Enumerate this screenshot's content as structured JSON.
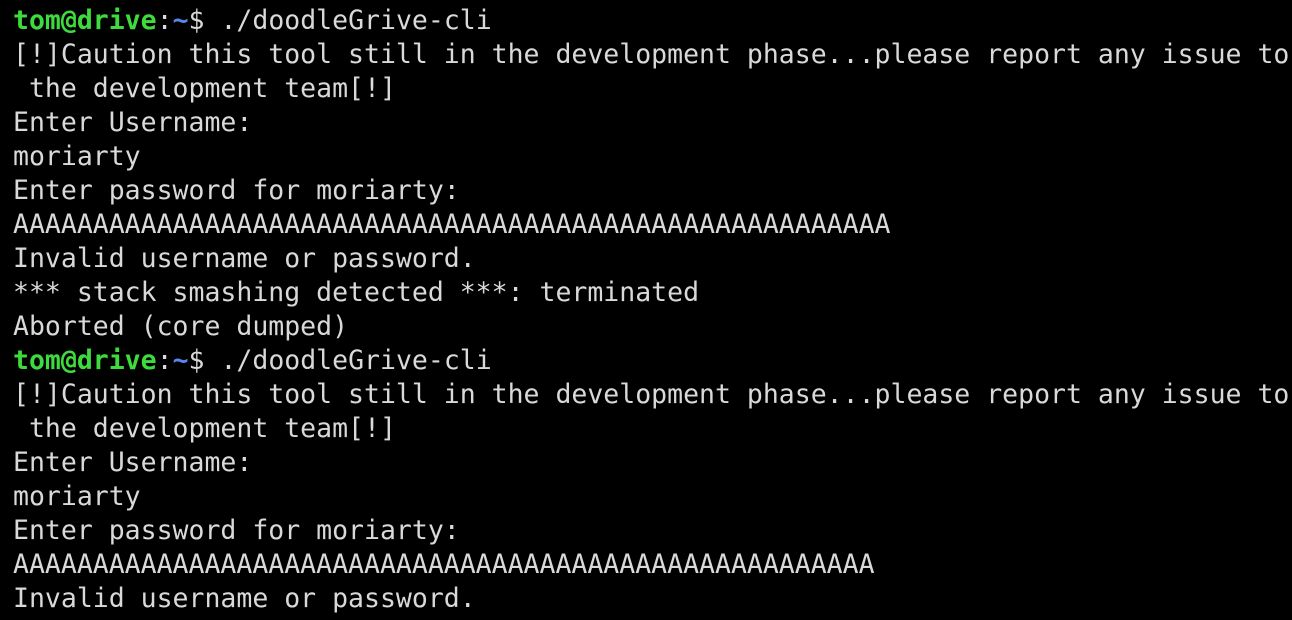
{
  "terminal": {
    "prompt": {
      "user_host": "tom@drive",
      "colon": ":",
      "cwd": "~",
      "sign": "$ "
    },
    "colors": {
      "background": "#000000",
      "text": "#d9d9d9",
      "prompt_user": "#3ddb3d",
      "prompt_path": "#5b86f0"
    },
    "lines": [
      {
        "type": "prompt",
        "command": "./doodleGrive-cli"
      },
      {
        "type": "output",
        "text": "[!]Caution this tool still in the development phase...please report any issue to"
      },
      {
        "type": "output",
        "text": " the development team[!]"
      },
      {
        "type": "output",
        "text": "Enter Username:"
      },
      {
        "type": "output",
        "text": "moriarty"
      },
      {
        "type": "output",
        "text": "Enter password for moriarty:"
      },
      {
        "type": "output",
        "text": "AAAAAAAAAAAAAAAAAAAAAAAAAAAAAAAAAAAAAAAAAAAAAAAAAAAAAAA"
      },
      {
        "type": "output",
        "text": "Invalid username or password."
      },
      {
        "type": "output",
        "text": "*** stack smashing detected ***: terminated"
      },
      {
        "type": "output",
        "text": "Aborted (core dumped)"
      },
      {
        "type": "prompt",
        "command": "./doodleGrive-cli"
      },
      {
        "type": "output",
        "text": "[!]Caution this tool still in the development phase...please report any issue to"
      },
      {
        "type": "output",
        "text": " the development team[!]"
      },
      {
        "type": "output",
        "text": "Enter Username:"
      },
      {
        "type": "output",
        "text": "moriarty"
      },
      {
        "type": "output",
        "text": "Enter password for moriarty:"
      },
      {
        "type": "output",
        "text": "AAAAAAAAAAAAAAAAAAAAAAAAAAAAAAAAAAAAAAAAAAAAAAAAAAAAAA"
      },
      {
        "type": "output",
        "text": "Invalid username or password."
      }
    ]
  }
}
